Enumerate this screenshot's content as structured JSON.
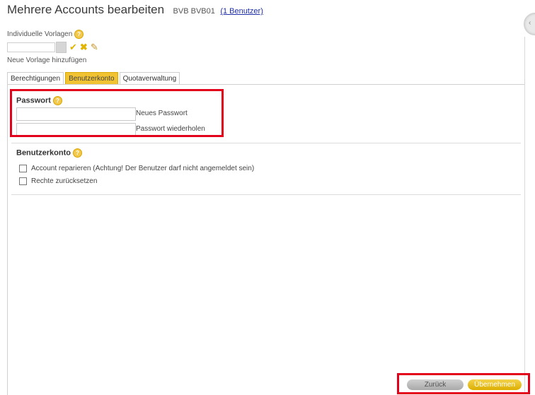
{
  "header": {
    "title": "Mehrere Accounts bearbeiten",
    "subtitle": "BVB BVB01",
    "users_link": "(1 Benutzer)"
  },
  "templates": {
    "label": "Individuelle Vorlagen",
    "add_new": "Neue Vorlage hinzufügen",
    "icons": [
      "check-icon",
      "delete-icon",
      "pencil-icon"
    ]
  },
  "tabs": [
    {
      "label": "Berechtigungen",
      "active": false
    },
    {
      "label": "Benutzerkonto",
      "active": true
    },
    {
      "label": "Quotaverwaltung",
      "active": false
    }
  ],
  "password": {
    "title": "Passwort",
    "new_label": "Neues Passwort",
    "repeat_label": "Passwort wiederholen",
    "new_value": "",
    "repeat_value": ""
  },
  "account": {
    "title": "Benutzerkonto",
    "options": [
      {
        "label": "Account reparieren (Achtung! Der Benutzer darf nicht angemeldet sein)",
        "checked": false
      },
      {
        "label": "Rechte zurücksetzen",
        "checked": false
      }
    ]
  },
  "buttons": {
    "back": "Zurück",
    "apply": "Übernehmen"
  },
  "colors": {
    "accent": "#f1c232",
    "highlight": "#e3001b",
    "link": "#1f2fa8"
  }
}
